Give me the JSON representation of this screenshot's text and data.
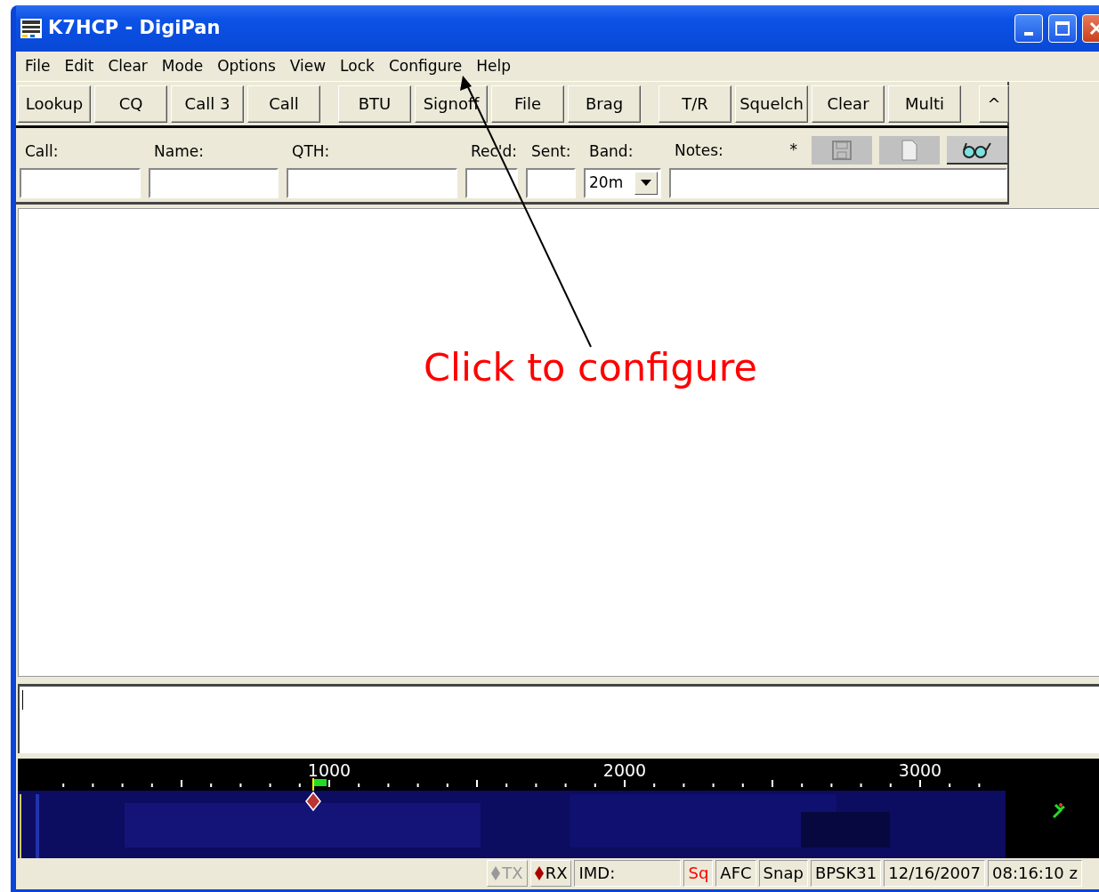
{
  "window": {
    "title": "K7HCP - DigiPan"
  },
  "menu": [
    "File",
    "Edit",
    "Clear",
    "Mode",
    "Options",
    "View",
    "Lock",
    "Configure",
    "Help"
  ],
  "toolbar_groups": [
    [
      "Lookup",
      "CQ",
      "Call 3",
      "Call"
    ],
    [
      "BTU",
      "Signoff",
      "File",
      "Brag"
    ],
    [
      "T/R",
      "Squelch",
      "Clear",
      "Multi"
    ],
    [
      "^"
    ]
  ],
  "fields": [
    {
      "label": "Call:",
      "kind": "text"
    },
    {
      "label": "Name:",
      "kind": "text"
    },
    {
      "label": "QTH:",
      "kind": "text"
    },
    {
      "label": "Rec'd:",
      "kind": "text"
    },
    {
      "label": "Sent:",
      "kind": "text"
    },
    {
      "label": "Band:",
      "kind": "select",
      "value": "20m"
    },
    {
      "label": "Notes:",
      "kind": "text"
    }
  ],
  "notes_marker": "*",
  "log_buttons": [
    {
      "kind": "save",
      "disabled": true
    },
    {
      "kind": "page",
      "disabled": true
    },
    {
      "kind": "glasses",
      "disabled": false
    }
  ],
  "waterfall": {
    "scale_labels": [
      "1000",
      "2000",
      "3000"
    ]
  },
  "status_bar": [
    {
      "text": "TX",
      "kind": "indicator",
      "active": false
    },
    {
      "text": "RX",
      "kind": "indicator",
      "active": true
    },
    {
      "text": "IMD:",
      "kind": "field",
      "color": "#000000"
    },
    {
      "text": "Sq",
      "kind": "field",
      "color": "#ff0000"
    },
    {
      "text": "AFC",
      "kind": "field",
      "color": "#000000"
    },
    {
      "text": "Snap",
      "kind": "field",
      "color": "#000000"
    },
    {
      "text": "BPSK31",
      "kind": "field",
      "color": "#000000"
    },
    {
      "text": "12/16/2007",
      "kind": "field",
      "color": "#000000"
    },
    {
      "text": "08:16:10 z",
      "kind": "field",
      "color": "#000000"
    }
  ],
  "annotation": {
    "text": "Click to configure"
  }
}
